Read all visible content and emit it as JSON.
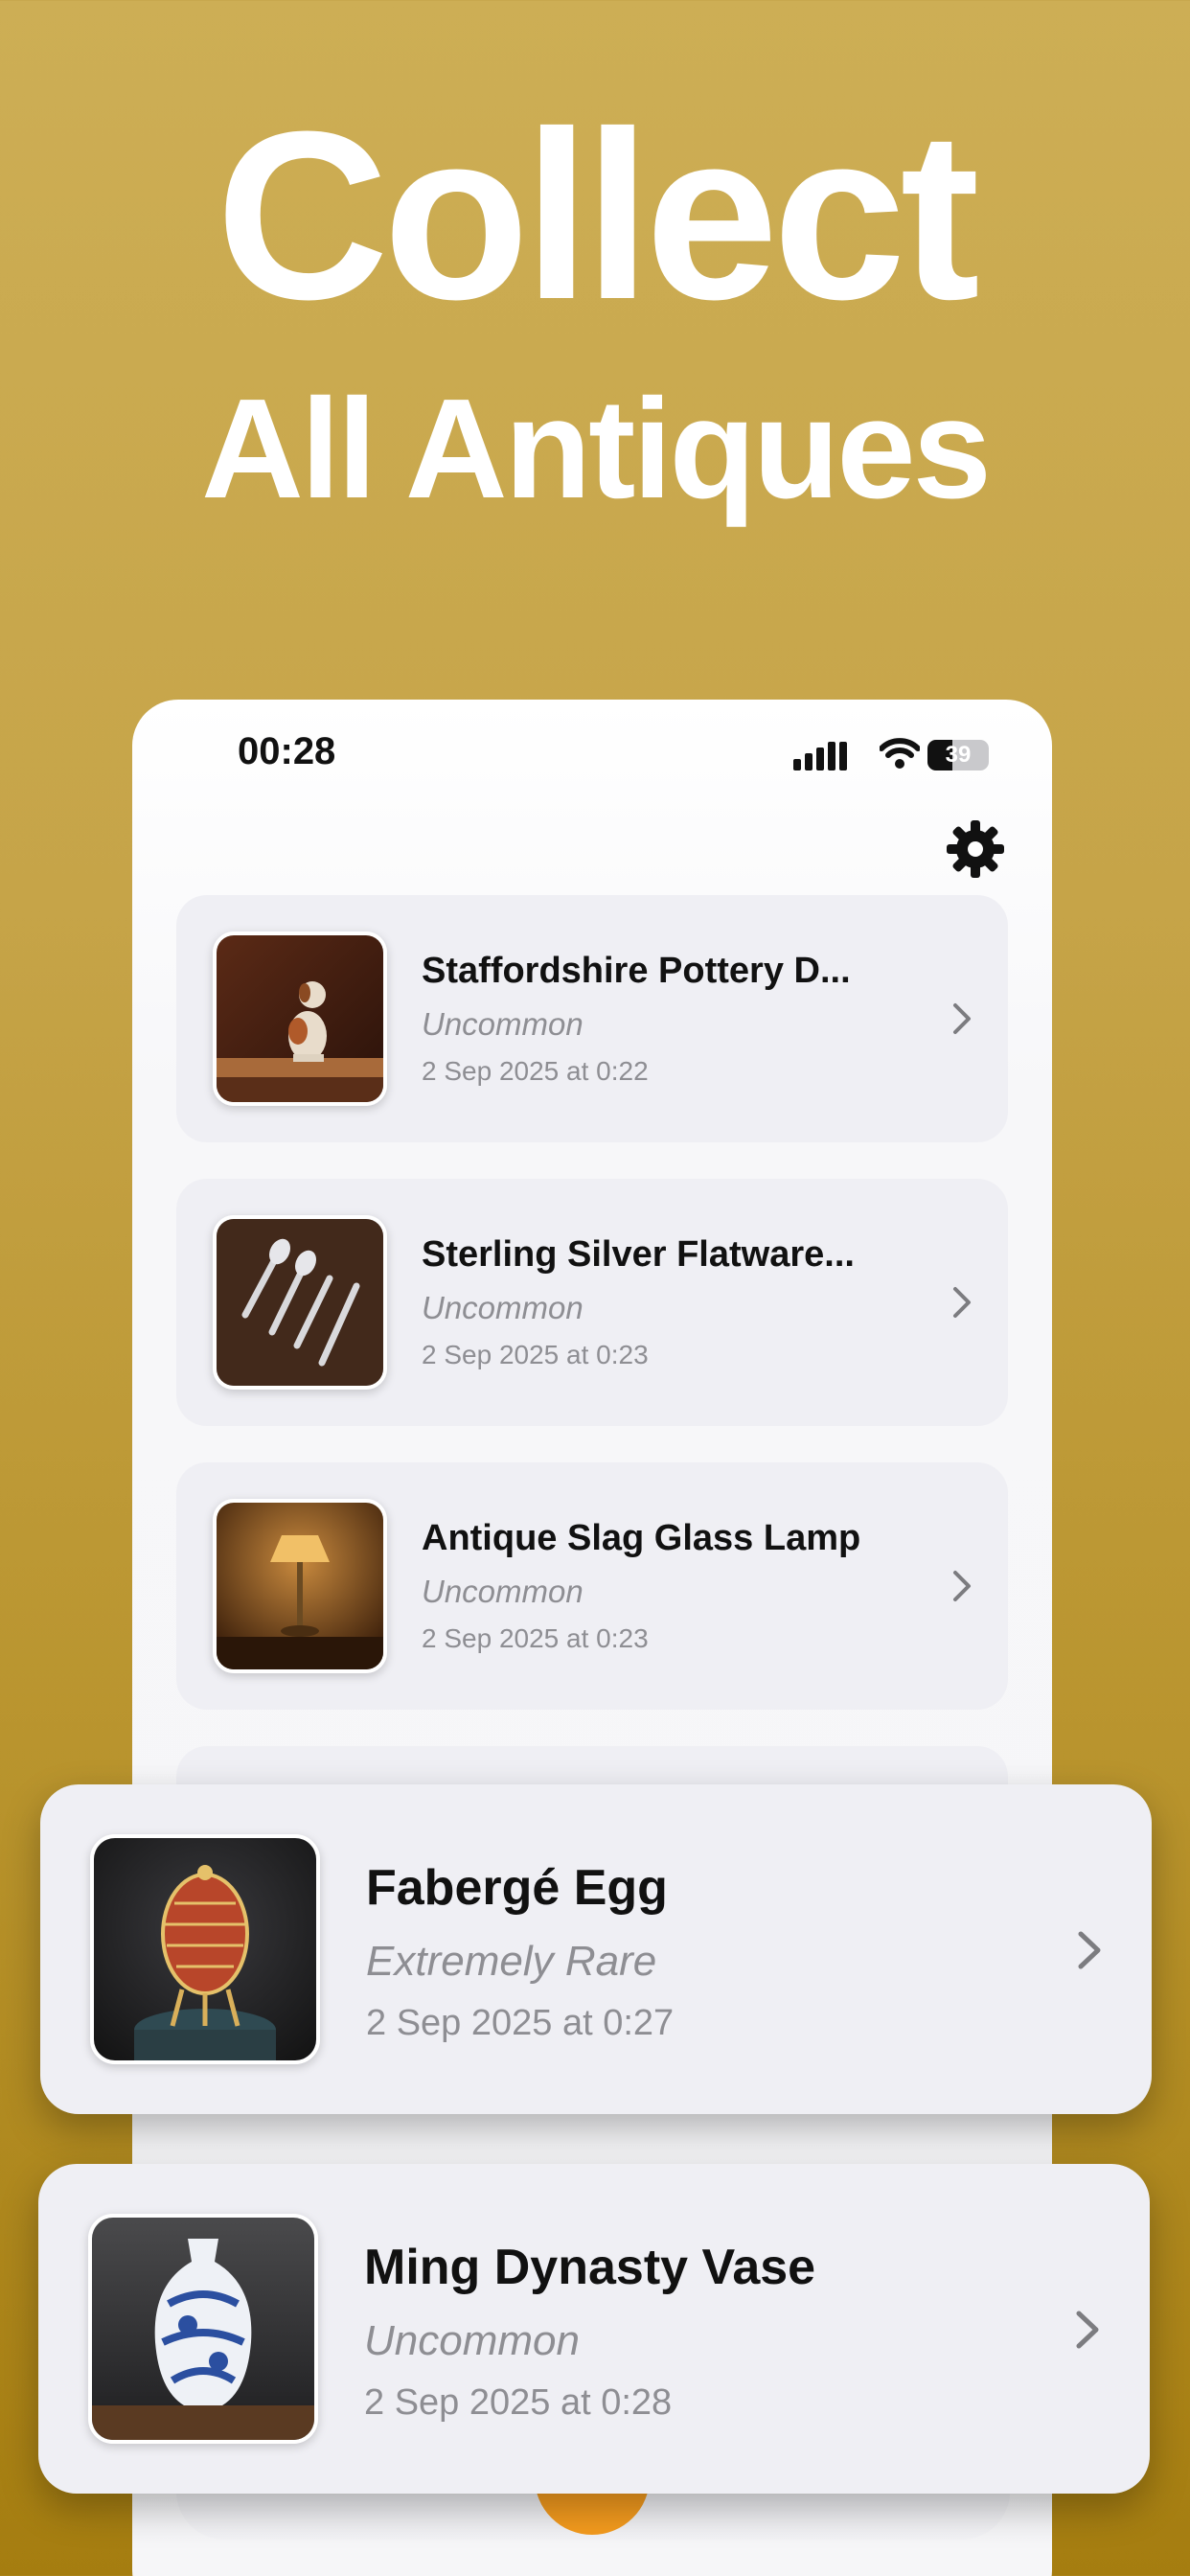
{
  "hero": {
    "line1": "Collect",
    "line2": "All Antiques"
  },
  "status_bar": {
    "time": "00:28",
    "battery": "39"
  },
  "icons": {
    "settings": "gear-icon",
    "chevron": "chevron-right-icon",
    "signal": "cellular-signal-icon",
    "wifi": "wifi-icon",
    "battery": "battery-icon"
  },
  "colors": {
    "background_top": "#cdae55",
    "background_bottom": "#a57d10",
    "card": "#efeff4",
    "secondary_text": "#8e8e93",
    "accent_orange": "#f49b1e"
  },
  "list": {
    "items": [
      {
        "title": "Staffordshire Pottery D...",
        "rarity": "Uncommon",
        "date": "2 Sep 2025 at 0:22",
        "image": "porcelain-dog-figurine"
      },
      {
        "title": "Sterling Silver Flatware...",
        "rarity": "Uncommon",
        "date": "2 Sep 2025 at 0:23",
        "image": "silver-flatware"
      },
      {
        "title": "Antique Slag Glass Lamp",
        "rarity": "Uncommon",
        "date": "2 Sep 2025 at 0:23",
        "image": "slag-glass-lamp"
      }
    ]
  },
  "featured": [
    {
      "title": "Fabergé Egg",
      "rarity": "Extremely Rare",
      "date": "2 Sep 2025 at 0:27",
      "image": "faberge-egg"
    },
    {
      "title": "Ming Dynasty Vase",
      "rarity": "Uncommon",
      "date": "2 Sep 2025 at 0:28",
      "image": "blue-white-vase"
    }
  ]
}
